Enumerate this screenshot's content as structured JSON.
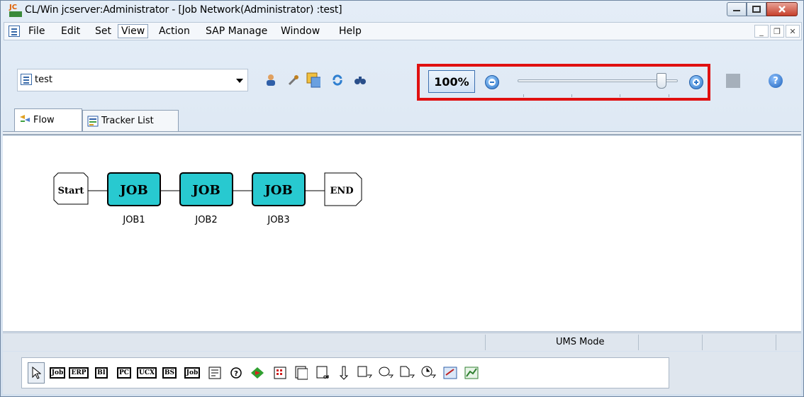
{
  "window": {
    "title": "CL/Win jcserver:Administrator - [Job Network(Administrator) :test]",
    "app_icon": "jc-app-icon",
    "controls": [
      "minimize",
      "maximize",
      "close"
    ]
  },
  "menu": {
    "items": [
      "File",
      "Edit",
      "Set",
      "View",
      "Action",
      "SAP Manage",
      "Window",
      "Help"
    ],
    "active": "View"
  },
  "toolbar": {
    "network_select": "test",
    "zoom_percent": "100%",
    "zoom_level": 0.9
  },
  "tabs": [
    {
      "label": "Flow",
      "icon": "flow-icon",
      "active": true
    },
    {
      "label": "Tracker List",
      "icon": "tracker-list-icon",
      "active": false
    }
  ],
  "flow": {
    "start": "Start",
    "end": "END",
    "jobs": [
      {
        "box": "JOB",
        "name": "JOB1"
      },
      {
        "box": "JOB",
        "name": "JOB2"
      },
      {
        "box": "JOB",
        "name": "JOB3"
      }
    ]
  },
  "status": {
    "mode": "UMS Mode"
  },
  "palette": {
    "items": [
      "Job",
      "ERP",
      "BI",
      "PC",
      "UCX",
      "BS",
      "Job"
    ]
  },
  "colors": {
    "job_fill": "#28c9d0",
    "highlight": "#e01010"
  }
}
